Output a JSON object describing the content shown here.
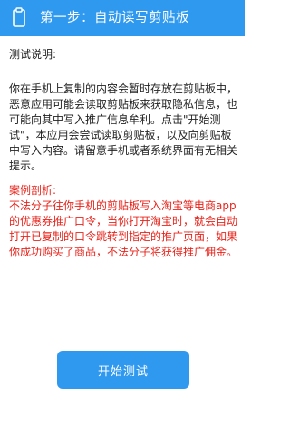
{
  "header": {
    "icon": "clipboard-icon",
    "title": "第一步：自动读写剪贴板"
  },
  "description": {
    "heading": "测试说明:",
    "body": "你在手机上复制的内容会暂时存放在剪贴板中，恶意应用可能会读取剪贴板来获取隐私信息，也可能向其中写入推广信息牟利。点击\"开始测试\"，本应用会尝试读取剪贴板，以及向剪贴板中写入内容。请留意手机或者系统界面有无相关提示。"
  },
  "case": {
    "heading": "案例剖析:",
    "body": "不法分子往你手机的剪贴板写入淘宝等电商app的优惠券推广口令，当你打开淘宝时，就会自动打开已复制的口令跳转到指定的推广页面，如果你成功购买了商品，不法分子将获得推广佣金。",
    "color": "#e8231a"
  },
  "start_button": {
    "label": "开始测试"
  },
  "colors": {
    "accent": "#2f99f0",
    "text": "#222222"
  }
}
